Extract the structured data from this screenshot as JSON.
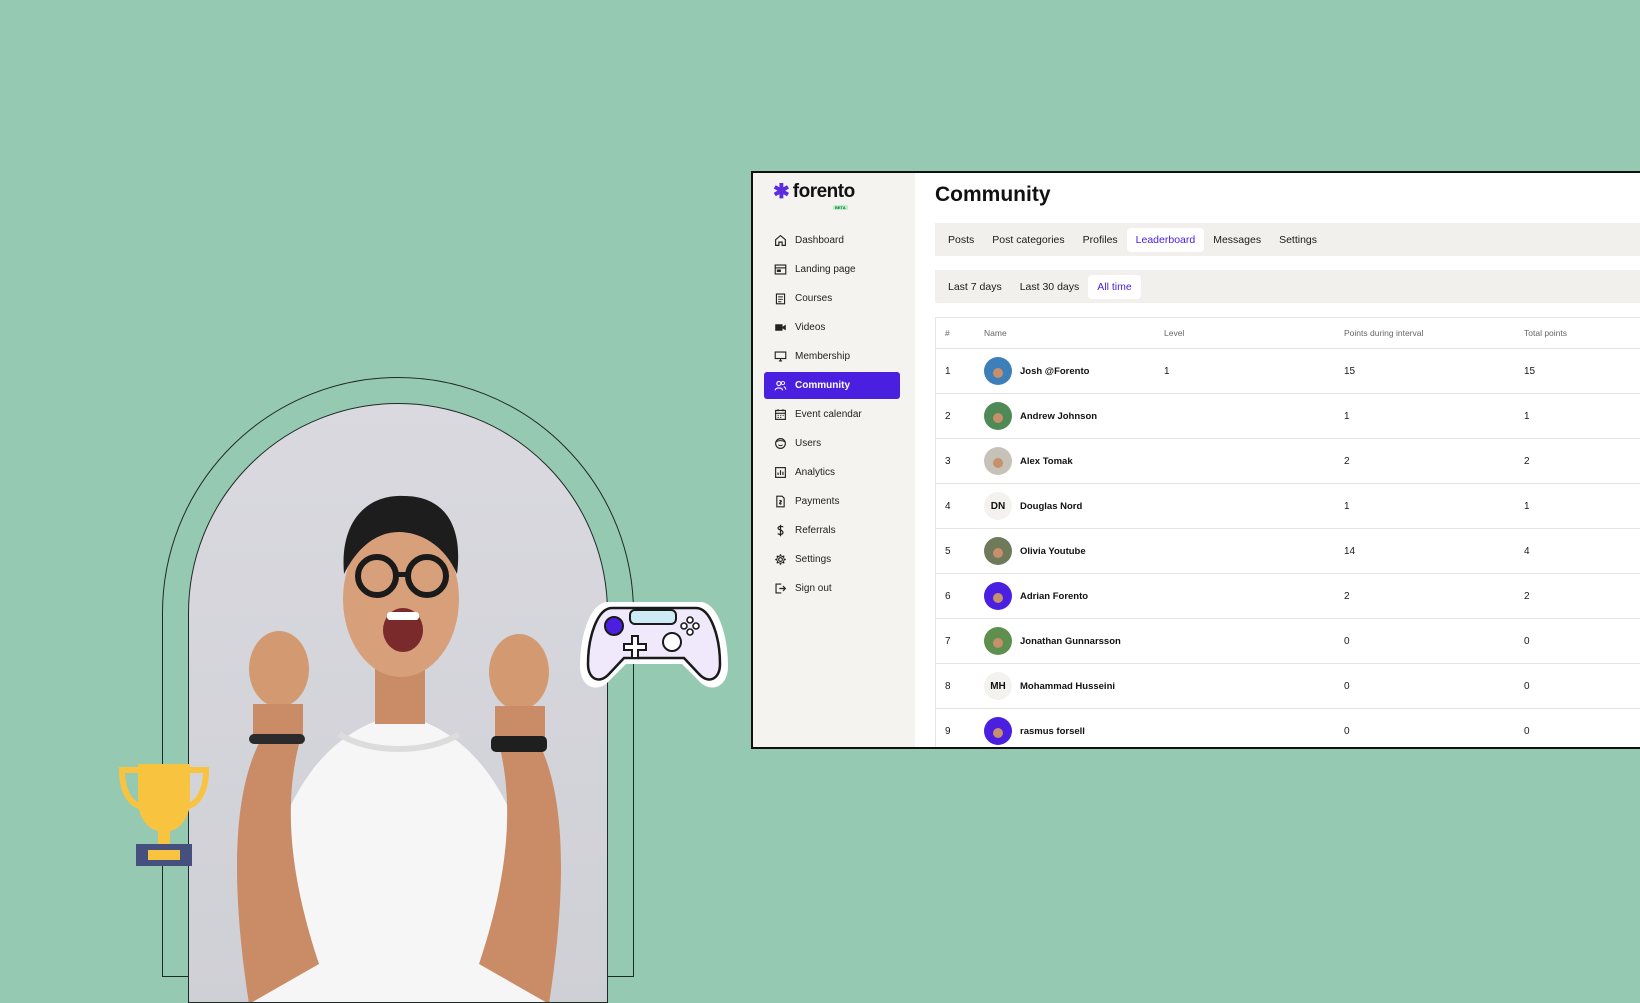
{
  "app": {
    "logo_text": "forento",
    "logo_badge": "BETA",
    "page_title": "Community"
  },
  "sidebar": {
    "items": [
      {
        "label": "Dashboard",
        "icon": "home-icon",
        "active": false
      },
      {
        "label": "Landing page",
        "icon": "browser-icon",
        "active": false
      },
      {
        "label": "Courses",
        "icon": "clipboard-icon",
        "active": false
      },
      {
        "label": "Videos",
        "icon": "video-camera-icon",
        "active": false
      },
      {
        "label": "Membership",
        "icon": "monitor-icon",
        "active": false
      },
      {
        "label": "Community",
        "icon": "people-icon",
        "active": true
      },
      {
        "label": "Event calendar",
        "icon": "calendar-icon",
        "active": false
      },
      {
        "label": "Users",
        "icon": "smiley-icon",
        "active": false
      },
      {
        "label": "Analytics",
        "icon": "chart-icon",
        "active": false
      },
      {
        "label": "Payments",
        "icon": "invoice-icon",
        "active": false
      },
      {
        "label": "Referrals",
        "icon": "dollar-icon",
        "active": false
      },
      {
        "label": "Settings",
        "icon": "gear-icon",
        "active": false
      },
      {
        "label": "Sign out",
        "icon": "sign-out-icon",
        "active": false
      }
    ]
  },
  "tabs": [
    {
      "label": "Posts",
      "active": false
    },
    {
      "label": "Post categories",
      "active": false
    },
    {
      "label": "Profiles",
      "active": false
    },
    {
      "label": "Leaderboard",
      "active": true
    },
    {
      "label": "Messages",
      "active": false
    },
    {
      "label": "Settings",
      "active": false
    }
  ],
  "ranges": [
    {
      "label": "Last 7 days",
      "active": false
    },
    {
      "label": "Last 30 days",
      "active": false
    },
    {
      "label": "All time",
      "active": true
    }
  ],
  "table": {
    "headers": {
      "rank": "#",
      "name": "Name",
      "level": "Level",
      "interval": "Points during interval",
      "total": "Total points"
    },
    "rows": [
      {
        "rank": "1",
        "name": "Josh @Forento",
        "level": "1",
        "interval": "15",
        "total": "15",
        "initials": "",
        "avatar_color": "#3d7fb8"
      },
      {
        "rank": "2",
        "name": "Andrew Johnson",
        "level": "",
        "interval": "1",
        "total": "1",
        "initials": "",
        "avatar_color": "#4f8a56"
      },
      {
        "rank": "3",
        "name": "Alex Tomak",
        "level": "",
        "interval": "2",
        "total": "2",
        "initials": "",
        "avatar_color": "#c7c2b8"
      },
      {
        "rank": "4",
        "name": "Douglas Nord",
        "level": "",
        "interval": "1",
        "total": "1",
        "initials": "DN",
        "avatar_color": ""
      },
      {
        "rank": "5",
        "name": "Olivia Youtube",
        "level": "",
        "interval": "14",
        "total": "4",
        "initials": "",
        "avatar_color": "#6f7a5a"
      },
      {
        "rank": "6",
        "name": "Adrian Forento",
        "level": "",
        "interval": "2",
        "total": "2",
        "initials": "",
        "avatar_color": "#4a1fe0"
      },
      {
        "rank": "7",
        "name": "Jonathan Gunnarsson",
        "level": "",
        "interval": "0",
        "total": "0",
        "initials": "",
        "avatar_color": "#5f8f4e"
      },
      {
        "rank": "8",
        "name": "Mohammad Husseini",
        "level": "",
        "interval": "0",
        "total": "0",
        "initials": "MH",
        "avatar_color": ""
      },
      {
        "rank": "9",
        "name": "rasmus forsell",
        "level": "",
        "interval": "0",
        "total": "0",
        "initials": "",
        "avatar_color": "#4a1fe0"
      }
    ]
  },
  "colors": {
    "background": "#96c9b2",
    "accent": "#4a1fe0",
    "trophy": "#f8c33f",
    "trophy_base": "#46507e"
  }
}
